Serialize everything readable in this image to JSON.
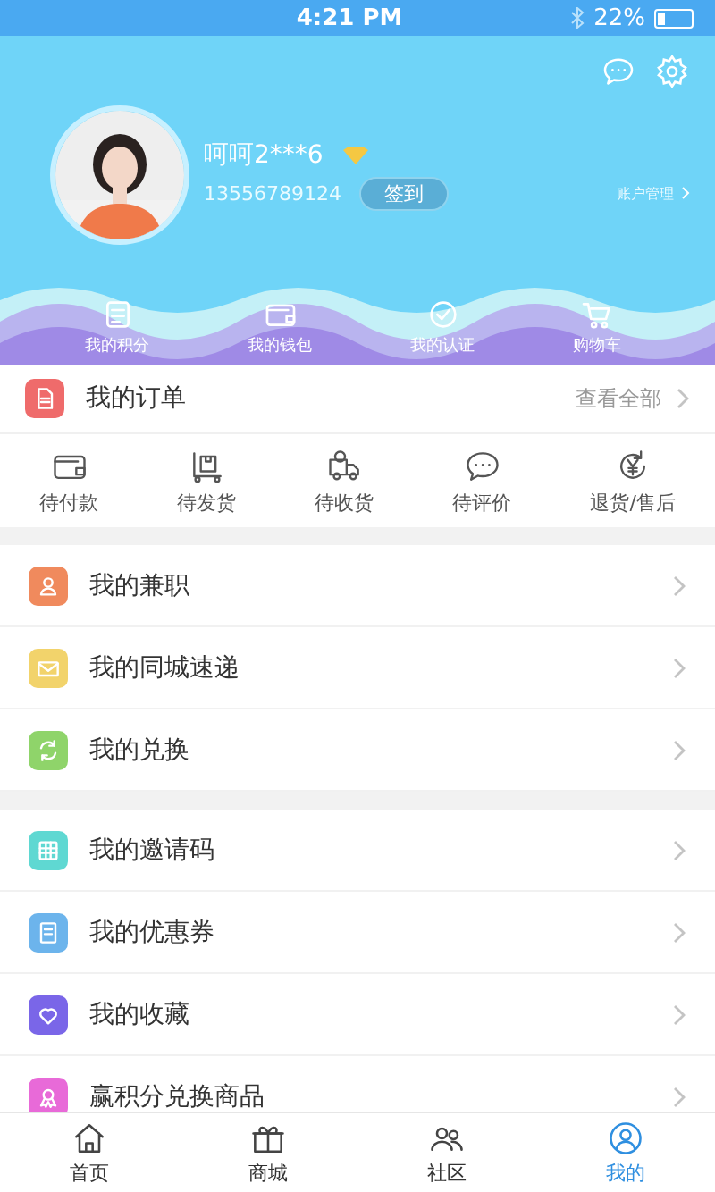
{
  "status_bar": {
    "time": "4:21 PM",
    "battery": "22%"
  },
  "profile": {
    "name": "呵呵2***6",
    "phone": "13556789124",
    "sign_in_button": "签到",
    "account_link": "账户管理"
  },
  "quick_links": [
    {
      "label": "我的积分",
      "kind": "points"
    },
    {
      "label": "我的钱包",
      "kind": "wallet"
    },
    {
      "label": "我的认证",
      "kind": "shield"
    },
    {
      "label": "购物车",
      "kind": "cart"
    }
  ],
  "orders": {
    "title": "我的订单",
    "view_all": "查看全部",
    "statuses": [
      {
        "label": "待付款",
        "kind": "wallet"
      },
      {
        "label": "待发货",
        "kind": "box"
      },
      {
        "label": "待收货",
        "kind": "truck"
      },
      {
        "label": "待评价",
        "kind": "chat"
      },
      {
        "label": "退货/售后",
        "kind": "yen"
      }
    ]
  },
  "menu_groups": [
    [
      {
        "label": "我的兼职",
        "kind": "person",
        "color": "#f08a5d"
      },
      {
        "label": "我的同城速递",
        "kind": "mail",
        "color": "#f2d36b"
      },
      {
        "label": "我的兑换",
        "kind": "exchange",
        "color": "#8fd46a"
      }
    ],
    [
      {
        "label": "我的邀请码",
        "kind": "grid",
        "color": "#5fd8d2"
      },
      {
        "label": "我的优惠券",
        "kind": "coupon",
        "color": "#6cb4ec"
      },
      {
        "label": "我的收藏",
        "kind": "heart",
        "color": "#7a66e8"
      },
      {
        "label": "赢积分兑换商品",
        "kind": "award",
        "color": "#e86ad8"
      }
    ]
  ],
  "tab_bar": [
    {
      "label": "首页",
      "kind": "home",
      "selected": false
    },
    {
      "label": "商城",
      "kind": "gift",
      "selected": false
    },
    {
      "label": "社区",
      "kind": "community",
      "selected": false
    },
    {
      "label": "我的",
      "kind": "me",
      "selected": true
    }
  ]
}
